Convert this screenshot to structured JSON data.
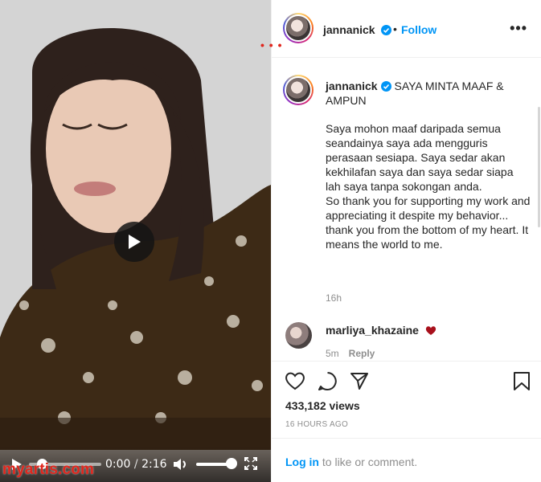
{
  "video": {
    "watermark": "myartis.com",
    "current_time": "0:00",
    "separator": "/",
    "duration": "2:16",
    "progress_fraction": 0.0,
    "volume_fraction": 0.85
  },
  "header": {
    "username": "jannanick",
    "dot": "•",
    "follow_label": "Follow",
    "more_label": "•••",
    "red_marker": "• • •"
  },
  "caption": {
    "username": "jannanick",
    "title": "SAYA MINTA MAAF & AMPUN",
    "body": "Saya mohon maaf daripada semua seandainya saya ada mengguris perasaan sesiapa. Saya sedar akan kekhilafan saya dan saya sedar siapa lah saya tanpa sokongan anda.\nSo thank you for supporting my work and appreciating it despite my behavior... thank you from the bottom of my heart. It means the world to me.",
    "time": "16h"
  },
  "comment": {
    "username": "marliya_khazaine",
    "time": "5m",
    "reply_label": "Reply"
  },
  "actions": {
    "views": "433,182 views",
    "posted_ago": "16 HOURS AGO"
  },
  "login": {
    "login_label": "Log in",
    "rest": " to like or comment."
  },
  "colors": {
    "link_blue": "#0095f6",
    "heart_red": "#a8101c",
    "watermark_red": "#e0261d",
    "muted": "#8e8e8e"
  },
  "icons": {
    "verified": "verified-badge-icon",
    "like": "heart-outline-icon",
    "comment": "speech-bubble-icon",
    "share": "paper-plane-icon",
    "save": "bookmark-icon",
    "play": "play-icon",
    "volume": "speaker-icon",
    "fullscreen": "fullscreen-icon"
  }
}
